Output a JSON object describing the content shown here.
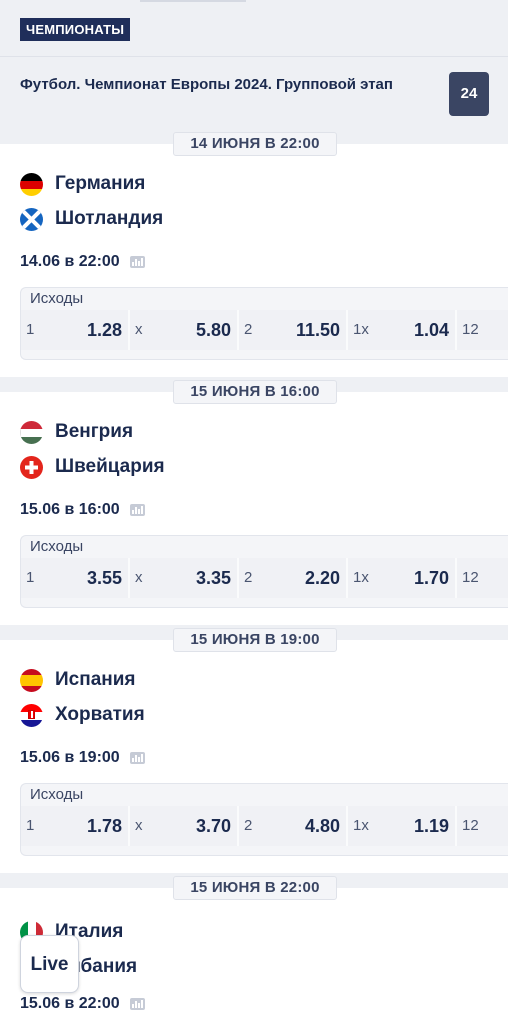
{
  "header": {
    "champ_badge": "ЧЕМПИОНАТЫ",
    "league_title": "Футбол. Чемпионат Европы 2024. Групповой этап",
    "league_count": "24"
  },
  "outcomes_title": "Исходы",
  "events": [
    {
      "date_chip": "14 ИЮНЯ В 22:00",
      "team1": "Германия",
      "team2": "Шотландия",
      "time": "14.06 в 22:00",
      "odds": [
        {
          "label": "1",
          "value": "1.28"
        },
        {
          "label": "x",
          "value": "5.80"
        },
        {
          "label": "2",
          "value": "11.50"
        },
        {
          "label": "1x",
          "value": "1.04"
        },
        {
          "label": "12",
          "value": ""
        }
      ]
    },
    {
      "date_chip": "15 ИЮНЯ В 16:00",
      "team1": "Венгрия",
      "team2": "Швейцария",
      "time": "15.06 в 16:00",
      "odds": [
        {
          "label": "1",
          "value": "3.55"
        },
        {
          "label": "x",
          "value": "3.35"
        },
        {
          "label": "2",
          "value": "2.20"
        },
        {
          "label": "1x",
          "value": "1.70"
        },
        {
          "label": "12",
          "value": ""
        }
      ]
    },
    {
      "date_chip": "15 ИЮНЯ В 19:00",
      "team1": "Испания",
      "team2": "Хорватия",
      "time": "15.06 в 19:00",
      "odds": [
        {
          "label": "1",
          "value": "1.78"
        },
        {
          "label": "x",
          "value": "3.70"
        },
        {
          "label": "2",
          "value": "4.80"
        },
        {
          "label": "1x",
          "value": "1.19"
        },
        {
          "label": "12",
          "value": ""
        }
      ]
    },
    {
      "date_chip": "15 ИЮНЯ В 22:00",
      "team1": "Италия",
      "team2": "Албания",
      "time": "15.06 в 22:00"
    }
  ],
  "live_button": "Live",
  "icons": {
    "stats": "stats-icon",
    "flags": [
      "germany-flag-icon",
      "scotland-flag-icon",
      "hungary-flag-icon",
      "switzerland-flag-icon",
      "spain-flag-icon",
      "croatia-flag-icon",
      "italy-flag-icon"
    ]
  },
  "colors": {
    "brand_navy": "#1f2e5a",
    "count_badge": "#3a4563",
    "text": "#1b2a4e",
    "background": "#eef0f4"
  }
}
